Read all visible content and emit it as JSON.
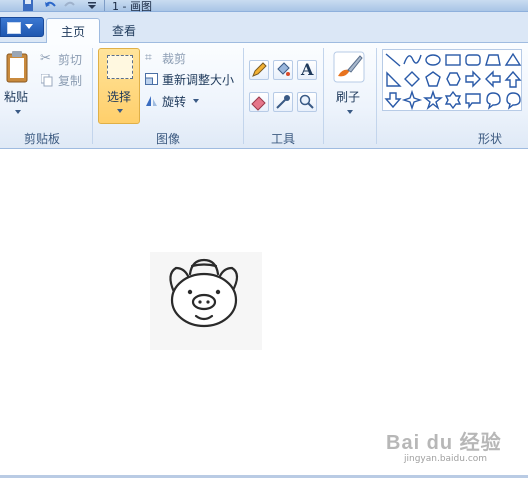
{
  "window": {
    "title": "1 - 画图"
  },
  "tabs": [
    {
      "label": "主页",
      "active": true
    },
    {
      "label": "查看",
      "active": false
    }
  ],
  "clipboard": {
    "paste": "粘贴",
    "cut": "剪切",
    "copy": "复制",
    "group": "剪贴板"
  },
  "image": {
    "select": "选择",
    "crop": "裁剪",
    "resize": "重新调整大小",
    "rotate": "旋转",
    "group": "图像"
  },
  "tools": {
    "group": "工具",
    "items": [
      "pencil-icon",
      "fill-icon",
      "text-icon",
      "eraser-icon",
      "color-picker-icon",
      "magnifier-icon"
    ]
  },
  "brushes": {
    "label": "刷子"
  },
  "shapes": {
    "group": "形状",
    "items": [
      "line",
      "curve",
      "oval",
      "rectangle",
      "rounded-rectangle",
      "polygon",
      "triangle",
      "right-triangle",
      "diamond",
      "pentagon",
      "hexagon",
      "right-arrow",
      "left-arrow",
      "up-arrow",
      "down-arrow",
      "four-point-star",
      "five-point-star",
      "six-point-star",
      "callout-rect",
      "callout-oval"
    ]
  },
  "watermark": {
    "text": "Bai du 经验",
    "sub": "jingyan.baidu.com"
  },
  "colors": {
    "accent": "#ffd57a",
    "file_button": "#2a62c0"
  }
}
